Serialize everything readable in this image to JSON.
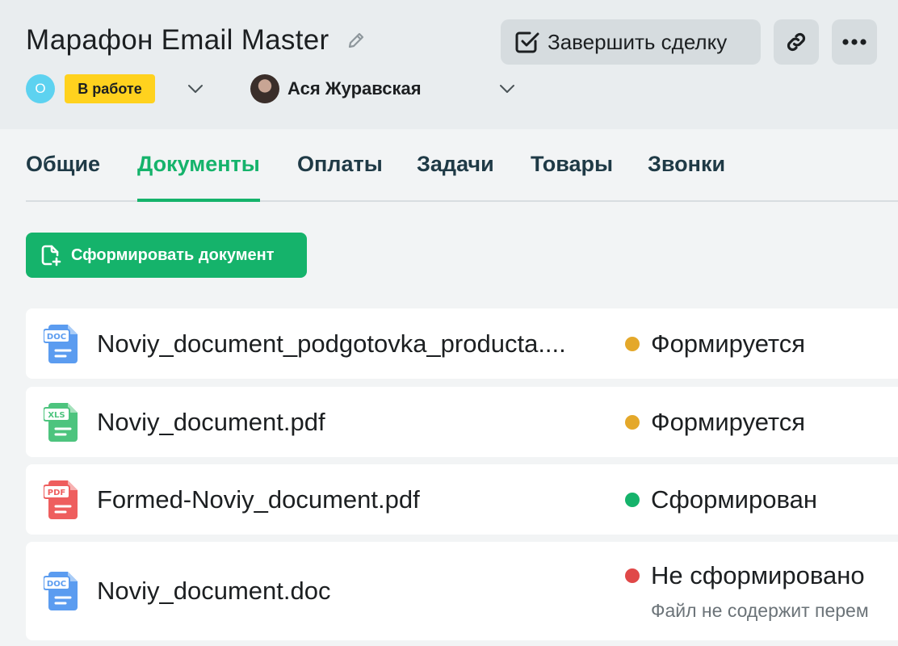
{
  "deal": {
    "title": "Марафон Email Master",
    "stage_initial": "О",
    "stage_label": "В работе",
    "owner_name": "Ася Журавская"
  },
  "actions": {
    "finish_label": "Завершить сделку"
  },
  "tabs": [
    {
      "label": "Общие"
    },
    {
      "label": "Документы"
    },
    {
      "label": "Оплаты"
    },
    {
      "label": "Задачи"
    },
    {
      "label": "Товары"
    },
    {
      "label": "Звонки"
    }
  ],
  "active_tab": "Документы",
  "create_doc_label": "Сформировать документ",
  "documents": [
    {
      "name": "Noviy_document_podgotovka_producta....",
      "type": "DOC",
      "icon": "doc-file-icon",
      "status": "Формируется",
      "status_color": "#e4a82a"
    },
    {
      "name": "Noviy_document.pdf",
      "type": "XLS",
      "icon": "xls-file-icon",
      "status": "Формируется",
      "status_color": "#e4a82a"
    },
    {
      "name": "Formed-Noviy_document.pdf",
      "type": "PDF",
      "icon": "pdf-file-icon",
      "status": "Сформирован",
      "status_color": "#15b36b"
    },
    {
      "name": "Noviy_document.doc",
      "type": "DOC",
      "icon": "doc-file-icon",
      "status": "Не сформировано",
      "status_color": "#e04848",
      "status_note": "Файл не содержит перем"
    }
  ],
  "colors": {
    "accent": "#15b36b",
    "badge": "#ffd21e",
    "doc_icon": "#5b9cf0",
    "xls_icon": "#4dc47e",
    "pdf_icon": "#ee5e5e"
  }
}
